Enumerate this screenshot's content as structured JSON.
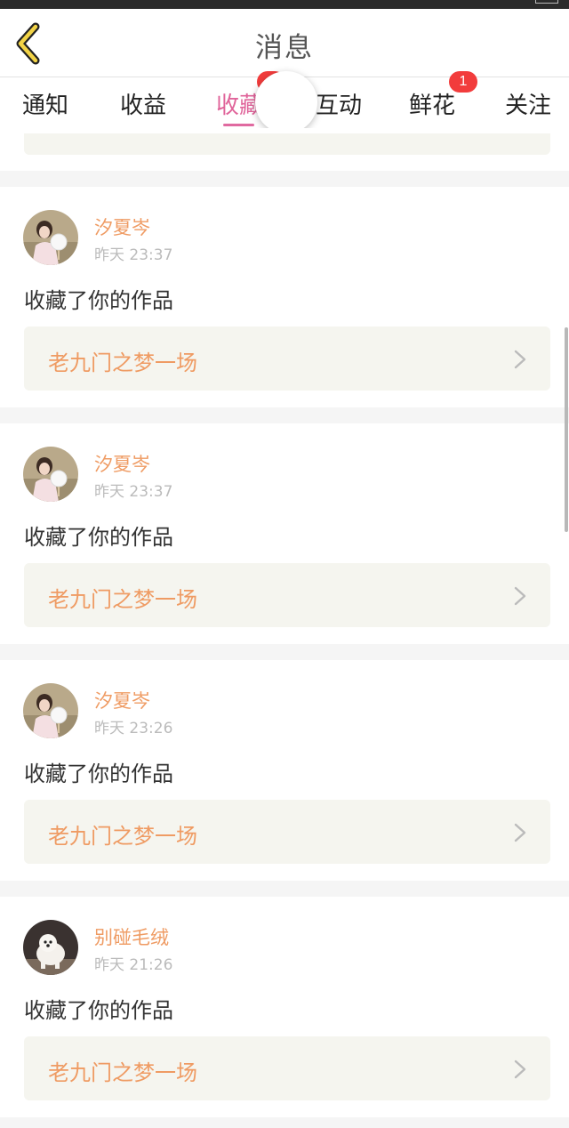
{
  "header": {
    "title": "消息"
  },
  "tabs": [
    {
      "label": "通知"
    },
    {
      "label": "收益"
    },
    {
      "label": "收藏"
    },
    {
      "label": "互动"
    },
    {
      "label": "鲜花",
      "badge": "1"
    },
    {
      "label": "关注"
    }
  ],
  "colors": {
    "accent": "#e0649a",
    "name": "#ef9b63",
    "badge": "#f23c3c",
    "card_bg": "#f5f5ef"
  },
  "icons": {
    "back": "chevron-left-icon",
    "arrow": "chevron-right-icon"
  },
  "items": [
    {
      "name": "汐夏岑",
      "time": "昨天 23:37",
      "message": "收藏了你的作品",
      "work": "老九门之梦一场",
      "avatar": "girl-avatar"
    },
    {
      "name": "汐夏岑",
      "time": "昨天 23:37",
      "message": "收藏了你的作品",
      "work": "老九门之梦一场",
      "avatar": "girl-avatar"
    },
    {
      "name": "汐夏岑",
      "time": "昨天 23:26",
      "message": "收藏了你的作品",
      "work": "老九门之梦一场",
      "avatar": "girl-avatar"
    },
    {
      "name": "别碰毛绒",
      "time": "昨天 21:26",
      "message": "收藏了你的作品",
      "work": "老九门之梦一场",
      "avatar": "dog-avatar"
    }
  ]
}
